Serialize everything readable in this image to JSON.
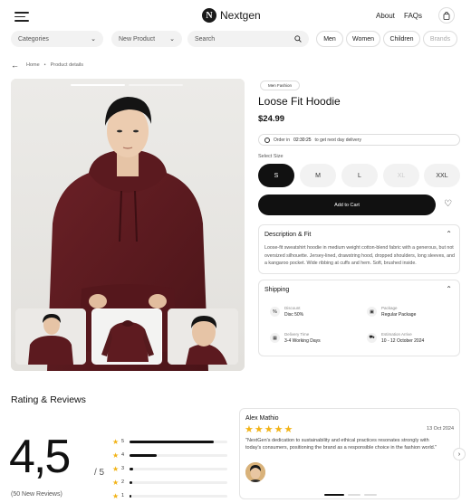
{
  "header": {
    "brand": "Nextgen",
    "brand_initial": "N",
    "nav": {
      "about": "About",
      "faqs": "FAQs"
    },
    "icons": {
      "menu": "menu-icon",
      "bag": "bag-icon"
    }
  },
  "filters": {
    "categories": "Categories",
    "new_product": "New Product",
    "search_placeholder": "Search",
    "chips": [
      "Men",
      "Women",
      "Children",
      "Brands"
    ]
  },
  "breadcrumb": {
    "home": "Home",
    "separator": "•",
    "current": "Product details"
  },
  "product": {
    "badge": "Men Fashion",
    "title": "Loose Fit Hoodie",
    "price": "$24.99",
    "delivery": {
      "prefix": "Order in",
      "countdown": "02:30:25",
      "suffix": "to get next day delivery"
    },
    "size_label": "Select Size",
    "sizes": [
      {
        "label": "S",
        "state": "selected"
      },
      {
        "label": "M",
        "state": "available"
      },
      {
        "label": "L",
        "state": "available"
      },
      {
        "label": "XL",
        "state": "disabled"
      },
      {
        "label": "XXL",
        "state": "available"
      }
    ],
    "add_to_cart": "Add to Cart",
    "description": {
      "heading": "Description & Fit",
      "text": "Loose-fit sweatshirt hoodie in medium weight cotton-blend fabric with a generous, but not oversized silhouette. Jersey-lined, drawstring hood, dropped shoulders, long sleeves, and a kangaroo pocket. Wide ribbing at cuffs and hem. Soft, brushed inside."
    },
    "shipping": {
      "heading": "Shipping",
      "items": [
        {
          "label": "Discount",
          "value": "Disc 50%",
          "icon": "discount-icon"
        },
        {
          "label": "Package",
          "value": "Regular Package",
          "icon": "package-icon"
        },
        {
          "label": "Delivery Time",
          "value": "3-4 Working Days",
          "icon": "calendar-icon"
        },
        {
          "label": "Estimation Arrive",
          "value": "10 - 12 October 2024",
          "icon": "truck-icon"
        }
      ]
    }
  },
  "reviews": {
    "heading": "Rating & Reviews",
    "score": "4,5",
    "out_of": "/ 5",
    "count": "(50 New Reviews)",
    "distribution": [
      {
        "stars": "5",
        "fraction": 0.86
      },
      {
        "stars": "4",
        "fraction": 0.28
      },
      {
        "stars": "3",
        "fraction": 0.04
      },
      {
        "stars": "2",
        "fraction": 0.03
      },
      {
        "stars": "1",
        "fraction": 0.02
      }
    ],
    "card": {
      "name": "Alex Mathio",
      "rating": 5,
      "stars": "★★★★★",
      "date": "13 Oct 2024",
      "text": "\"NextGen's dedication to sustainability and ethical practices resonates strongly with today's consumers, positioning the brand as a responsible choice in the fashion world.\""
    }
  },
  "colors": {
    "accent": "#111111",
    "star": "#f2b316",
    "hoodie": "#5a1a1f",
    "background": "#ffffff"
  }
}
